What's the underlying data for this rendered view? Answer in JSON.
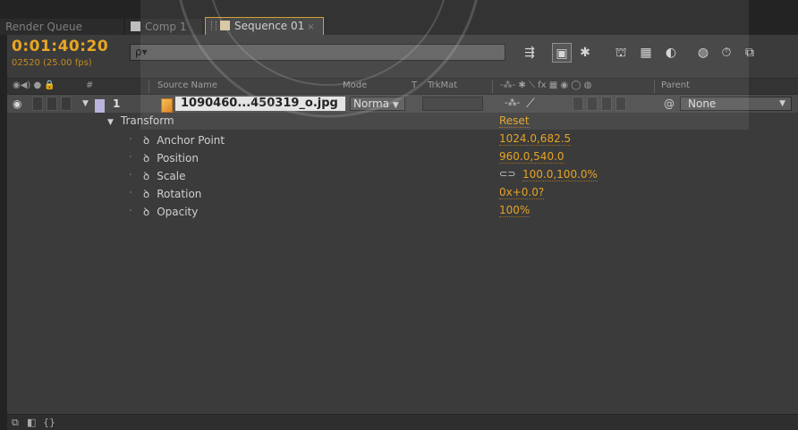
{
  "tabs": [
    {
      "label": "Render Queue",
      "active": false
    },
    {
      "label": "Comp 1",
      "active": false,
      "swatch": "#bdbdbd"
    },
    {
      "label": "Sequence 01",
      "active": true,
      "swatch": "#d9c8a0",
      "close": "×"
    }
  ],
  "timecode": {
    "value": "0:01:40:20",
    "frames": "02520 (25.00 fps)"
  },
  "search": {
    "placeholder": "",
    "glyph": "ρ▾"
  },
  "columns": {
    "av": "◉◀) ● 🔒",
    "label": "#",
    "source_name": "Source Name",
    "mode": "Mode",
    "t": "T",
    "trkmat": "TrkMat",
    "switches": "-⁂- ✱ ⟍ fx ▦ ◉ ◯ ◍",
    "parent": "Parent"
  },
  "layer": {
    "number": "1",
    "name": "1090460...450319_o.jpg",
    "mode": "Norma",
    "parent": "None"
  },
  "properties": [
    {
      "name": "Transform",
      "value": "Reset",
      "group": true
    },
    {
      "name": "Anchor Point",
      "value": "1024.0,682.5"
    },
    {
      "name": "Position",
      "value": "960.0,540.0"
    },
    {
      "name": "Scale",
      "value": "100.0,100.0%",
      "linked": true
    },
    {
      "name": "Rotation",
      "value": "0x+0.0?"
    },
    {
      "name": "Opacity",
      "value": "100%"
    }
  ],
  "footer": {
    "icons": [
      "comp-icon",
      "mask-icon",
      "toggle-icon"
    ]
  },
  "colors": {
    "accent": "#e6a325",
    "tab_border": "#d59e22",
    "label_color": "#b8b4dc"
  }
}
